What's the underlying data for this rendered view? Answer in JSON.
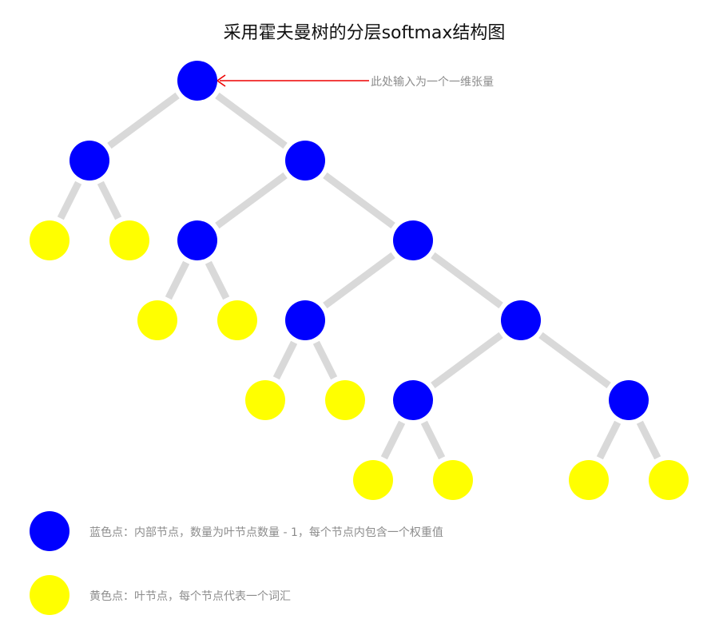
{
  "title": "采用霍夫曼树的分层softmax结构图",
  "annotation": {
    "text": "此处输入为一个一维张量"
  },
  "colors": {
    "internal": "#0000ff",
    "leaf": "#ffff00",
    "edge": "#d9d9d9",
    "arrow": "#ee0000",
    "text": "#8c8c8c"
  },
  "tree": {
    "nodes": [
      {
        "id": "root",
        "type": "internal"
      },
      {
        "id": "n1",
        "type": "internal"
      },
      {
        "id": "n2",
        "type": "internal"
      },
      {
        "id": "n3",
        "type": "internal"
      },
      {
        "id": "n4",
        "type": "internal"
      },
      {
        "id": "n5",
        "type": "internal"
      },
      {
        "id": "n6",
        "type": "internal"
      },
      {
        "id": "n7",
        "type": "internal"
      },
      {
        "id": "n8",
        "type": "internal"
      },
      {
        "id": "l1",
        "type": "leaf"
      },
      {
        "id": "l2",
        "type": "leaf"
      },
      {
        "id": "l3",
        "type": "leaf"
      },
      {
        "id": "l4",
        "type": "leaf"
      },
      {
        "id": "l5",
        "type": "leaf"
      },
      {
        "id": "l6",
        "type": "leaf"
      },
      {
        "id": "l7",
        "type": "leaf"
      },
      {
        "id": "l8",
        "type": "leaf"
      },
      {
        "id": "l9",
        "type": "leaf"
      },
      {
        "id": "l10",
        "type": "leaf"
      }
    ],
    "edges": [
      [
        "root",
        "n1"
      ],
      [
        "root",
        "n2"
      ],
      [
        "n1",
        "l1"
      ],
      [
        "n1",
        "l2"
      ],
      [
        "n2",
        "n3"
      ],
      [
        "n2",
        "n4"
      ],
      [
        "n3",
        "l3"
      ],
      [
        "n3",
        "l4"
      ],
      [
        "n4",
        "n5"
      ],
      [
        "n4",
        "n6"
      ],
      [
        "n5",
        "l5"
      ],
      [
        "n5",
        "l6"
      ],
      [
        "n6",
        "n7"
      ],
      [
        "n6",
        "n8"
      ],
      [
        "n7",
        "l7"
      ],
      [
        "n7",
        "l8"
      ],
      [
        "n8",
        "l9"
      ],
      [
        "n8",
        "l10"
      ]
    ]
  },
  "legend": [
    {
      "type": "internal",
      "text": "蓝色点：内部节点，数量为叶节点数量 - 1，每个节点内包含一个权重值"
    },
    {
      "type": "leaf",
      "text": "黄色点：叶节点，每个节点代表一个词汇"
    }
  ]
}
